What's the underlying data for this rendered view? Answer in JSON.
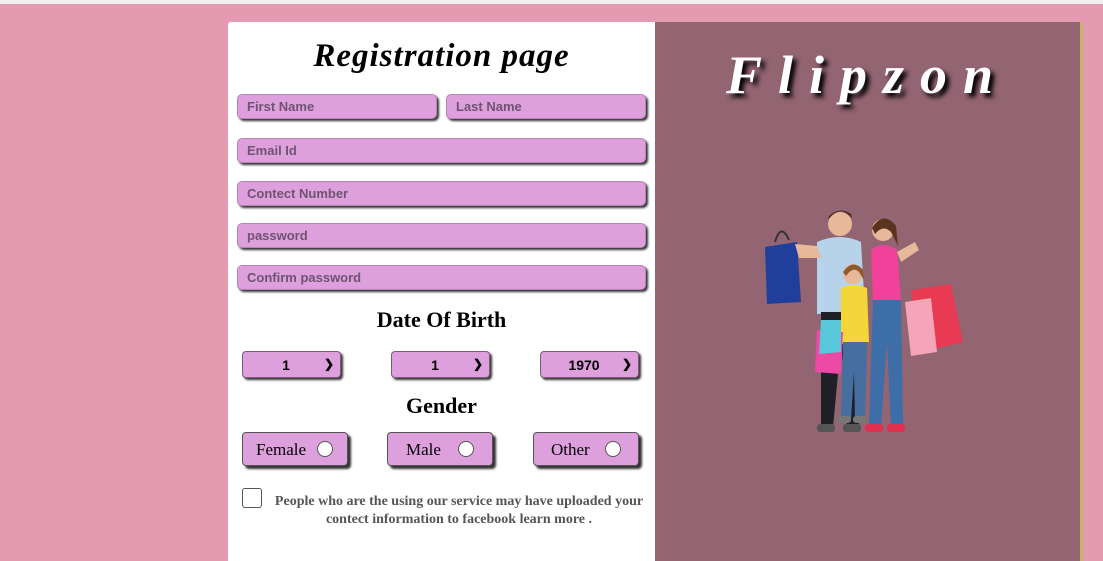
{
  "form": {
    "title": "Registration page",
    "fields": {
      "first_name": {
        "placeholder": "First Name",
        "value": ""
      },
      "last_name": {
        "placeholder": "Last Name",
        "value": ""
      },
      "email": {
        "placeholder": "Email Id",
        "value": ""
      },
      "contact": {
        "placeholder": "Contect Number",
        "value": ""
      },
      "password": {
        "placeholder": "password",
        "value": ""
      },
      "confirm_password": {
        "placeholder": "Confirm password",
        "value": ""
      }
    },
    "dob": {
      "heading": "Date Of Birth",
      "day": "1",
      "month": "1",
      "year": "1970"
    },
    "gender": {
      "heading": "Gender",
      "options": [
        "Female",
        "Male",
        "Other"
      ],
      "selected": null
    },
    "consent": {
      "checked": false,
      "text": "People who are the using our service may have uploaded your contect information to facebook learn more ."
    }
  },
  "brand": {
    "name": "Flipzon",
    "image": "family-shopping-bags"
  },
  "colors": {
    "page_background": "#e49bb1",
    "side_panel": "#936472",
    "field_fill": "#dea0dd",
    "accent_border": "#c7b36a"
  }
}
